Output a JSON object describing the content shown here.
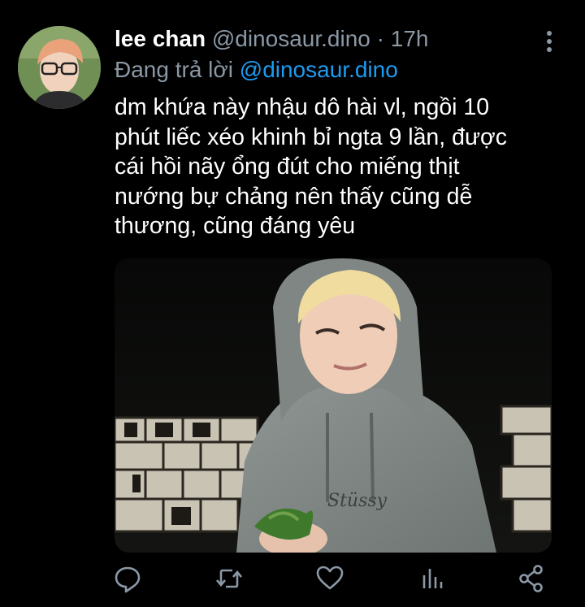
{
  "tweet": {
    "author_name": "lee chan",
    "handle": "@dinosaur.dino",
    "separator": "·",
    "time": "17h",
    "reply_prefix": "Đang trả lời",
    "reply_to": "@dinosaur.dino",
    "text_lines": [
      "dm khứa này nhậu dô hài vl, ngồi 10",
      "phút liếc xéo khinh bỉ ngta 9 lần, được",
      "cái hồi nãy ổng đút cho miếng thịt",
      "nướng bự chảng nên thấy cũng dễ",
      "thương, cũng đáng yêu"
    ],
    "media_shirt_text": "Stüssy"
  },
  "actions": {
    "reply_icon": "comment-icon",
    "retweet_icon": "retweet-icon",
    "like_icon": "heart-icon",
    "analytics_icon": "analytics-icon",
    "share_icon": "share-icon"
  },
  "colors": {
    "background": "#000000",
    "secondary_text": "#8b98a5",
    "link": "#1d9bf0",
    "icon": "#8b98a5"
  }
}
